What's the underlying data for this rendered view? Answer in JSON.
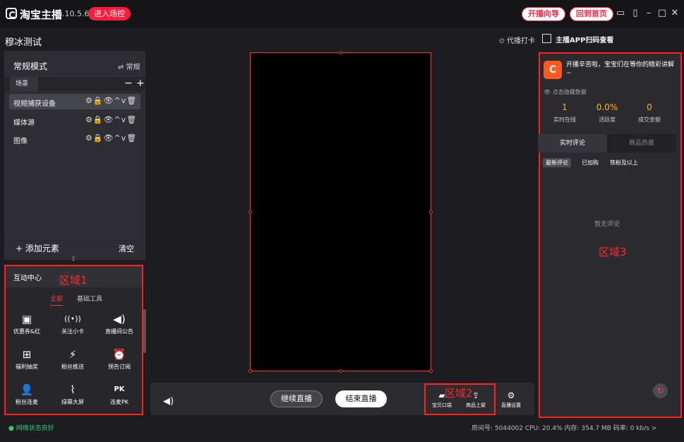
{
  "app": {
    "name": "淘宝主播",
    "version": "6.10.5.6",
    "enter_label": "进入场控"
  },
  "header": {
    "guide_label": "开播向导",
    "home_label": "回到首页",
    "window_icons": [
      "chat-icon",
      "file-icon",
      "minimize-icon",
      "maximize-icon",
      "close-icon"
    ]
  },
  "subbar": {
    "title": "穆冰测试",
    "clockin_label": "代播打卡",
    "qr_label": "主播APP扫码查看"
  },
  "sources": {
    "mode_label": "常规模式",
    "mode_switch": "⇌ 常规",
    "scene_tab": "场景",
    "items": [
      {
        "label": "视频捕获设备",
        "selected": true
      },
      {
        "label": "媒体源",
        "selected": false
      },
      {
        "label": "图像",
        "selected": false
      }
    ],
    "row_icons": "⚙🔒👁︎^v🗑",
    "add_label": "+ 添加元素",
    "clear_label": "清空"
  },
  "interaction": {
    "title": "互动中心",
    "region_label": "区域1",
    "tabs": [
      "全部",
      "基础工具"
    ],
    "tools": [
      {
        "label": "优惠券&红",
        "icon": "coupon-icon"
      },
      {
        "label": "关注小卡",
        "icon": "broadcast-icon"
      },
      {
        "label": "直播间公告",
        "icon": "speaker-icon"
      },
      {
        "label": "福利抽奖",
        "icon": "gift-icon"
      },
      {
        "label": "粉丝推送",
        "icon": "lightning-icon"
      },
      {
        "label": "预告订阅",
        "icon": "alarm-icon"
      },
      {
        "label": "粉丝连麦",
        "icon": "users-icon"
      },
      {
        "label": "绿幕大屏",
        "icon": "chart-icon"
      },
      {
        "label": "连麦PK",
        "icon": "pk-icon"
      }
    ]
  },
  "status": {
    "network": "● 网络状态良好",
    "line": "房间号: 5044002  CPU: 20.4%  内存: 354.7 MB  码率: 0 kb/s  >"
  },
  "controls": {
    "continue_label": "继续直播",
    "end_label": "结束直播",
    "region_label": "区域2",
    "tools": [
      {
        "label": "宝贝口袋",
        "icon": "bag-icon"
      },
      {
        "label": "商品上架",
        "icon": "upload-bag-icon"
      },
      {
        "label": "直播设置",
        "icon": "gear-icon"
      }
    ]
  },
  "right": {
    "notice": "开播辛苦啦，宝宝们在等你的精彩讲解~",
    "hide_data": "点击隐藏数据",
    "stats": [
      {
        "value": "1",
        "label": "实时在线"
      },
      {
        "value": "0.0%",
        "label": "活跃度"
      },
      {
        "value": "0",
        "label": "成交金额"
      }
    ],
    "tabs": [
      "实时评论",
      "商品热度"
    ],
    "filters": [
      "最新评论",
      "已加购",
      "铁粉及以上"
    ],
    "empty_text": "暂无评论",
    "region_label": "区域3"
  },
  "colors": {
    "accent": "#ff2a45",
    "stat": "#ffb21e",
    "network": "#2ecc71",
    "region_border": "#ff2020"
  }
}
